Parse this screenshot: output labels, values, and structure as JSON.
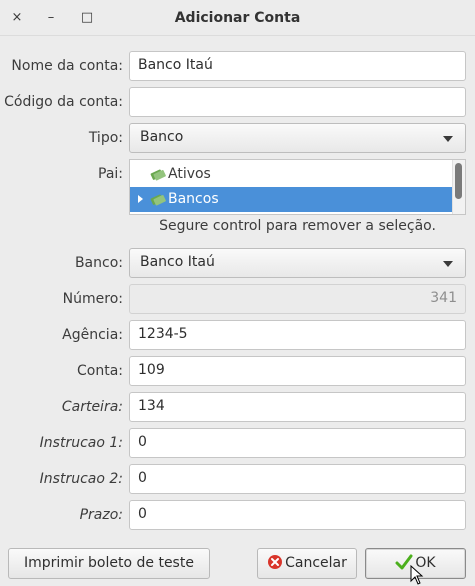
{
  "window": {
    "title": "Adicionar Conta",
    "close_glyph": "×",
    "minimize_glyph": "–",
    "maximize_glyph": "□"
  },
  "form": {
    "nome": {
      "label": "Nome da conta:",
      "value": "Banco Itaú"
    },
    "codigo": {
      "label": "Código da conta:",
      "value": ""
    },
    "tipo": {
      "label": "Tipo:",
      "value": "Banco"
    },
    "pai": {
      "label": "Pai:",
      "items": [
        {
          "label": "Ativos",
          "selected": false,
          "has_children": false,
          "icon": "money-icon"
        },
        {
          "label": "Bancos",
          "selected": true,
          "has_children": true,
          "icon": "money-icon"
        }
      ],
      "hint": "Segure control para remover a seleção."
    },
    "banco": {
      "label": "Banco:",
      "value": "Banco Itaú"
    },
    "numero": {
      "label": "Número:",
      "value": "341"
    },
    "agencia": {
      "label": "Agência:",
      "value": "1234-5"
    },
    "conta": {
      "label": "Conta:",
      "value": "109"
    },
    "carteira": {
      "label": "Carteira:",
      "value": "134"
    },
    "instrucao1": {
      "label": "Instrucao 1:",
      "value": "0"
    },
    "instrucao2": {
      "label": "Instrucao 2:",
      "value": "0"
    },
    "prazo": {
      "label": "Prazo:",
      "value": "0"
    }
  },
  "buttons": {
    "print": "Imprimir boleto de teste",
    "cancel": "Cancelar",
    "ok": "OK"
  },
  "colors": {
    "selection": "#4a90d9",
    "cancel_icon": "#d9352b",
    "ok_icon": "#4caf1d"
  }
}
